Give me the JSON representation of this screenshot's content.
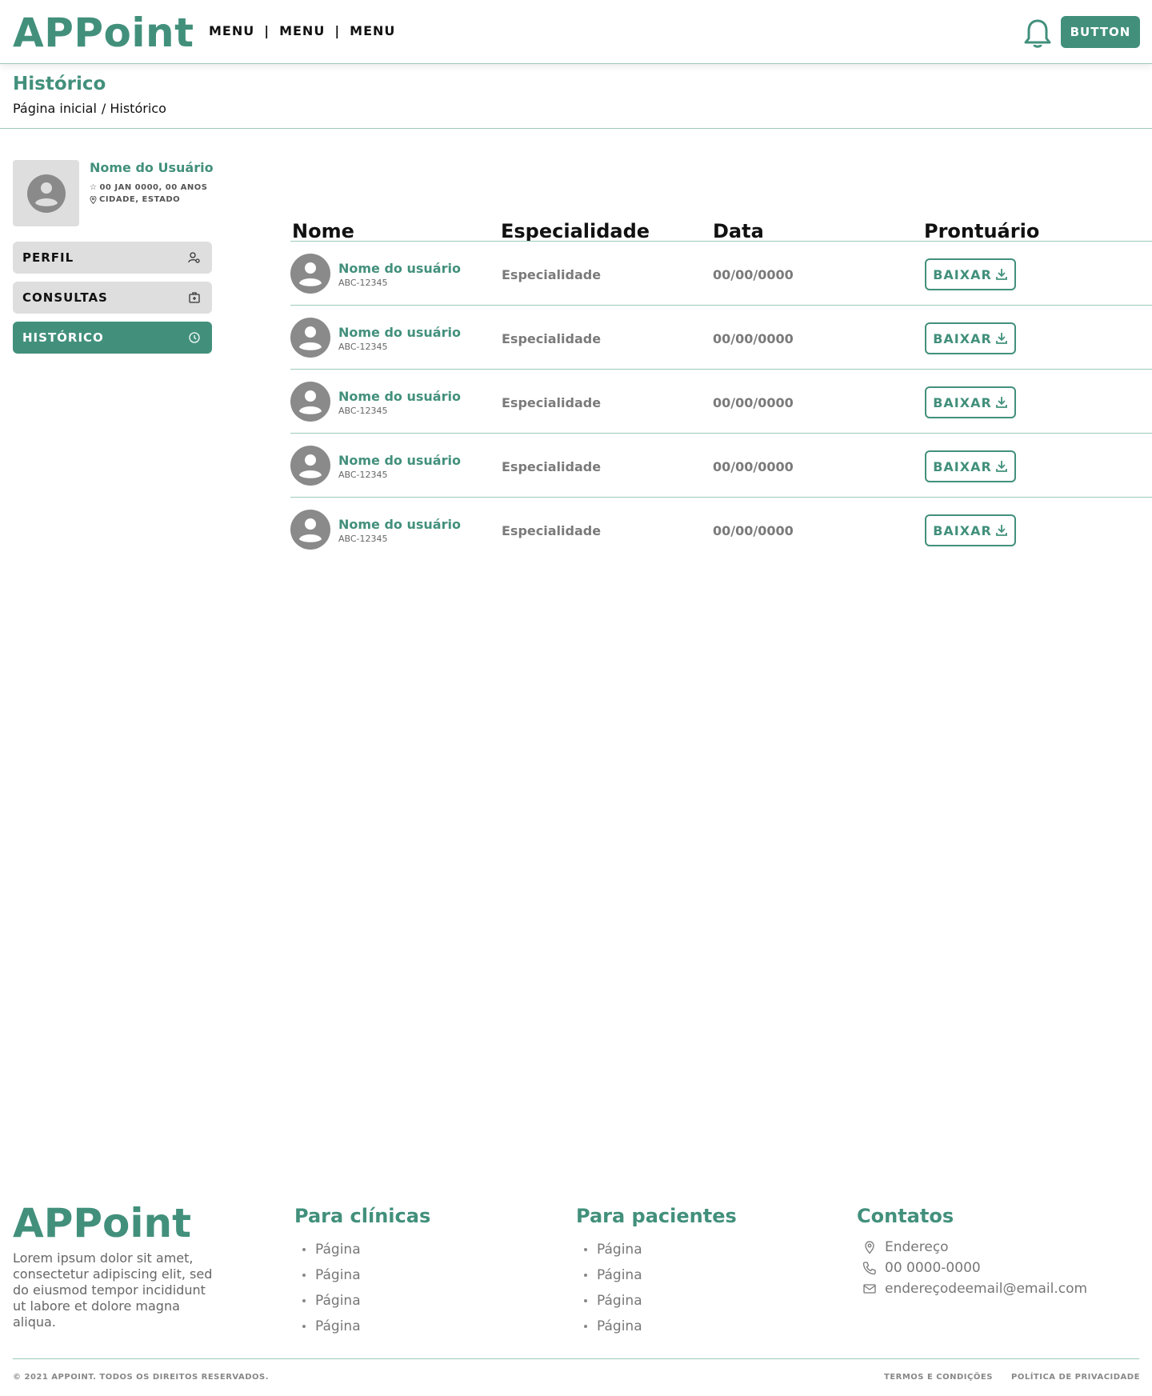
{
  "header": {
    "logo": "APPoint",
    "menu": [
      "MENU",
      "MENU",
      "MENU"
    ],
    "button_label": "BUTTON"
  },
  "page": {
    "title": "Histórico",
    "breadcrumb": [
      "Página inicial",
      "/ Histórico"
    ]
  },
  "profile": {
    "name": "Nome do Usuário",
    "birth": "00 JAN 0000, 00 ANOS",
    "location": "CIDADE, ESTADO"
  },
  "sidebar": {
    "items": [
      {
        "label": "PERFIL",
        "icon": "user-settings-icon",
        "active": false
      },
      {
        "label": "CONSULTAS",
        "icon": "medical-bag-icon",
        "active": false
      },
      {
        "label": "HISTÓRICO",
        "icon": "clock-icon",
        "active": true
      }
    ]
  },
  "table": {
    "headers": [
      "Nome",
      "Especialidade",
      "Data",
      "Prontuário"
    ],
    "rows": [
      {
        "name": "Nome do usuário",
        "code": "ABC-12345",
        "specialty": "Especialidade",
        "date": "00/00/0000",
        "action": "BAIXAR"
      },
      {
        "name": "Nome do usuário",
        "code": "ABC-12345",
        "specialty": "Especialidade",
        "date": "00/00/0000",
        "action": "BAIXAR"
      },
      {
        "name": "Nome do usuário",
        "code": "ABC-12345",
        "specialty": "Especialidade",
        "date": "00/00/0000",
        "action": "BAIXAR"
      },
      {
        "name": "Nome do usuário",
        "code": "ABC-12345",
        "specialty": "Especialidade",
        "date": "00/00/0000",
        "action": "BAIXAR"
      },
      {
        "name": "Nome do usuário",
        "code": "ABC-12345",
        "specialty": "Especialidade",
        "date": "00/00/0000",
        "action": "BAIXAR"
      }
    ]
  },
  "footer": {
    "logo": "APPoint",
    "description": "Lorem ipsum dolor sit amet, consectetur adipiscing elit, sed do eiusmod tempor incididunt ut labore et dolore magna aliqua.",
    "clinics": {
      "title": "Para clínicas",
      "links": [
        "Página",
        "Página",
        "Página",
        "Página"
      ]
    },
    "patients": {
      "title": "Para pacientes",
      "links": [
        "Página",
        "Página",
        "Página",
        "Página"
      ]
    },
    "contacts": {
      "title": "Contatos",
      "address": "Endereço",
      "phone": "00 0000-0000",
      "email": "endereçodeemail@email.com"
    },
    "copyright": "© 2021 APPOINT. TODOS OS DIREITOS RESERVADOS.",
    "terms": "TERMOS E CONDIÇÕES",
    "privacy": "POLÍTICA DE PRIVACIDADE"
  },
  "colors": {
    "accent": "#42907c",
    "divider": "#9cc9bb",
    "muted": "#7a7a7a",
    "sidebar_bg": "#dedede"
  }
}
